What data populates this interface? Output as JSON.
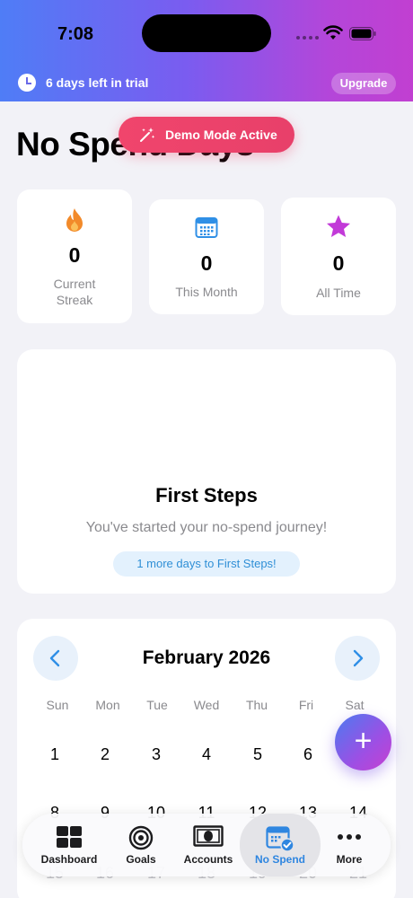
{
  "status_bar": {
    "time": "7:08"
  },
  "trial_banner": {
    "text": "6 days left in trial",
    "upgrade_label": "Upgrade"
  },
  "demo_banner": {
    "label": "Demo Mode Active"
  },
  "page": {
    "title": "No Spend Days"
  },
  "stats": [
    {
      "icon": "flame-icon",
      "value": "0",
      "label_line1": "Current",
      "label_line2": "Streak",
      "color": "#f28a2a"
    },
    {
      "icon": "calendar-icon",
      "value": "0",
      "label": "This Month",
      "color": "#2f8fe6"
    },
    {
      "icon": "star-icon",
      "value": "0",
      "label": "All Time",
      "color": "#c23ad8"
    }
  ],
  "milestone": {
    "title": "First Steps",
    "subtitle": "You've started your no-spend journey!",
    "badge": "1 more days to First Steps!"
  },
  "calendar": {
    "month_label": "February 2026",
    "weekdays": [
      "Sun",
      "Mon",
      "Tue",
      "Wed",
      "Thu",
      "Fri",
      "Sat"
    ],
    "week1": [
      "1",
      "2",
      "3",
      "4",
      "5",
      "6",
      "7"
    ],
    "week2": [
      "8",
      "9",
      "10",
      "11",
      "12",
      "13",
      "14"
    ],
    "week3": [
      "15",
      "16",
      "17",
      "18",
      "19",
      "20",
      "21"
    ]
  },
  "fab": {
    "label": "+"
  },
  "tabs": [
    {
      "label": "Dashboard",
      "icon": "dashboard-grid-icon"
    },
    {
      "label": "Goals",
      "icon": "target-icon"
    },
    {
      "label": "Accounts",
      "icon": "cash-icon"
    },
    {
      "label": "No Spend",
      "icon": "calendar-check-icon",
      "active": true
    },
    {
      "label": "More",
      "icon": "ellipsis-icon"
    }
  ],
  "colors": {
    "accent": "#2f86e0",
    "demo": "#f0456c",
    "gradient_start": "#4f7df6",
    "gradient_end": "#c13fd1"
  }
}
